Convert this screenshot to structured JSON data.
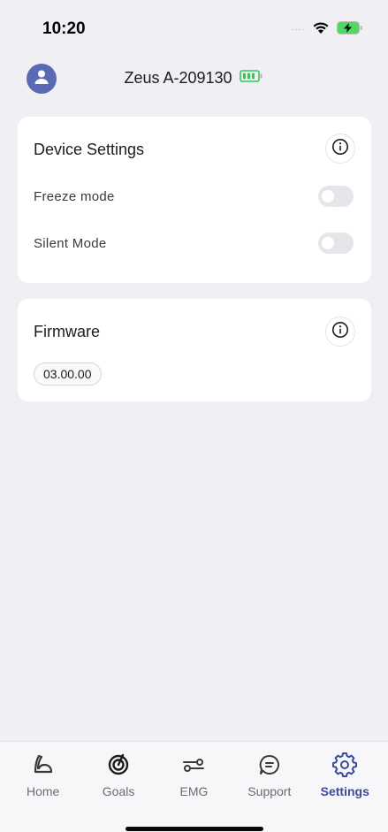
{
  "status_bar": {
    "time": "10:20",
    "signal": "....",
    "battery_color": "#4cd964"
  },
  "header": {
    "device_name": "Zeus A-209130",
    "device_battery_color": "#34c759",
    "avatar_color": "#5b6ab5",
    "avatar_icon": "user-icon"
  },
  "device_settings": {
    "title": "Device Settings",
    "info_icon": "info-icon",
    "rows": [
      {
        "label": "Freeze mode",
        "enabled": false
      },
      {
        "label": "Silent Mode",
        "enabled": false
      }
    ]
  },
  "firmware": {
    "title": "Firmware",
    "info_icon": "info-icon",
    "version": "03.00.00"
  },
  "tab_bar": {
    "accent_color": "#3b4a9c",
    "active": "Settings",
    "tabs": [
      {
        "label": "Home",
        "icon": "arm-flex-icon"
      },
      {
        "label": "Goals",
        "icon": "target-icon"
      },
      {
        "label": "EMG",
        "icon": "signal-path-icon"
      },
      {
        "label": "Support",
        "icon": "chat-icon"
      },
      {
        "label": "Settings",
        "icon": "gear-icon"
      }
    ]
  }
}
